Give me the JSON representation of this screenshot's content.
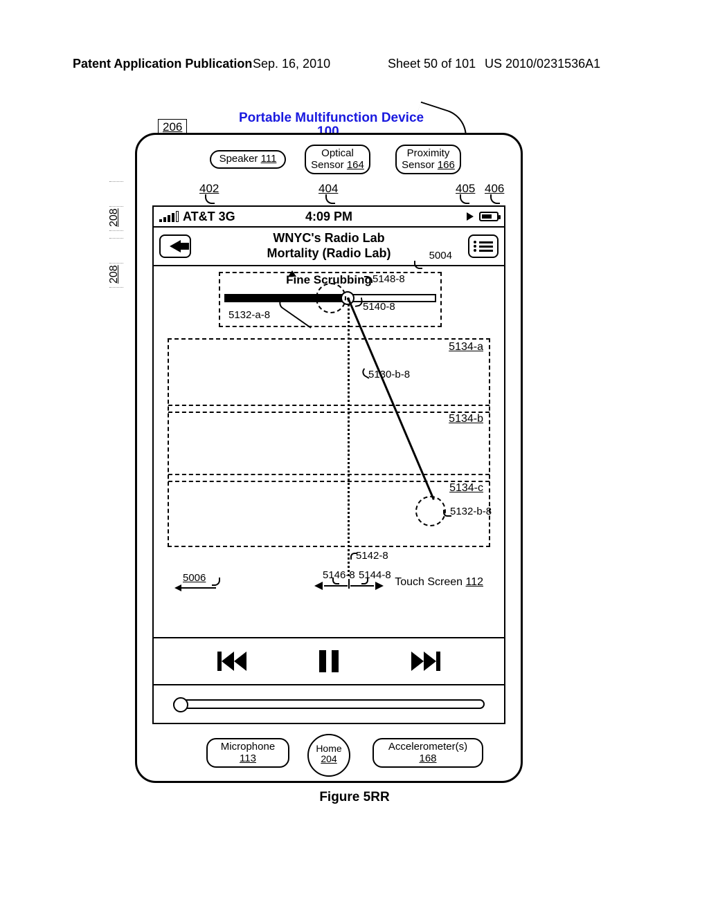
{
  "header": {
    "left": "Patent Application Publication",
    "date": "Sep. 16, 2010",
    "sheet": "Sheet 50 of 101",
    "pubno": "US 2010/0231536A1"
  },
  "side": {
    "ref208a": "208",
    "ref208b": "208"
  },
  "device": {
    "title": "Portable Multifunction Device",
    "title_num": "100",
    "ref206": "206",
    "speaker": "Speaker ",
    "speaker_num": "111",
    "optical": "Optical Sensor ",
    "optical_num": "164",
    "prox": "Proximity Sensor ",
    "prox_num": "166",
    "r402": "402",
    "r404": "404",
    "r405": "405",
    "r406": "406",
    "mic": "Microphone",
    "mic_num": "113",
    "home": "Home",
    "home_num": "204",
    "accel": "Accelerometer(s)",
    "accel_num": "168"
  },
  "status": {
    "carrier": "AT&T 3G",
    "time": "4:09 PM"
  },
  "nav": {
    "line1": "WNYC's Radio Lab",
    "line2": "Mortality (Radio Lab)",
    "r5004": "5004"
  },
  "scrub": {
    "fine": "Fine Scrubbing",
    "r5148": "5148-8",
    "r5132a": "5132-a-8",
    "r5140": "5140-8",
    "r5134a": "5134-a",
    "r5134b": "5134-b",
    "r5134c": "5134-c",
    "r5130": "5130-b-8",
    "r5132b": "5132-b-8",
    "r5142": "5142-8",
    "r5146": "5146-8",
    "r5144": "5144-8",
    "r5006": "5006",
    "touchscreen": "Touch Screen ",
    "touchscreen_num": "112"
  },
  "figure": "Figure 5RR"
}
